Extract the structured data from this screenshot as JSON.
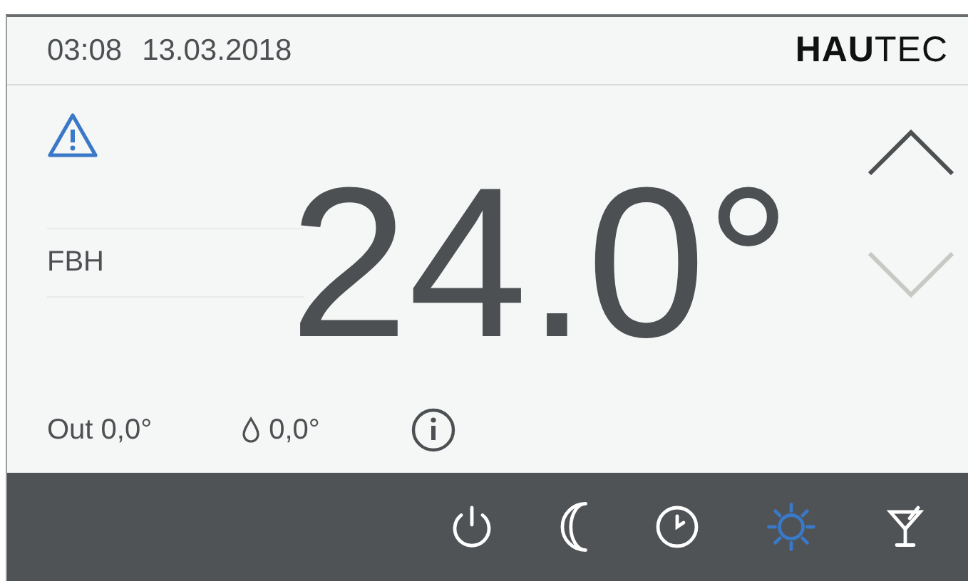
{
  "header": {
    "time": "03:08",
    "date": "13.03.2018",
    "logo": "**HAU**TEC"
  },
  "alert": {
    "shown": true
  },
  "zone": "FBH",
  "setpoint": "24.0°",
  "arrows": [
    {
      "kind": "up",
      "disabled": false
    },
    {
      "kind": "down",
      "disabled": true
    }
  ],
  "outside": "Out 0,0°",
  "humidity": "0,0°",
  "modes": [
    {
      "kind": "power",
      "selected": false
    },
    {
      "kind": "moon",
      "selected": false
    },
    {
      "kind": "clock",
      "selected": false
    },
    {
      "kind": "sun",
      "selected": true
    },
    {
      "kind": "cocktail",
      "selected": false
    }
  ]
}
